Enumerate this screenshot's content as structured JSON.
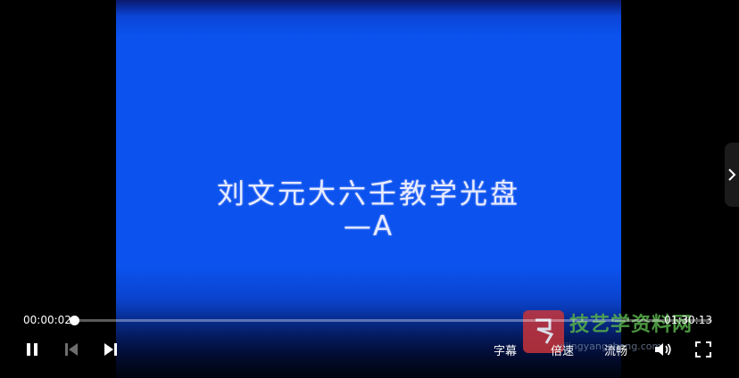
{
  "video": {
    "title_line1": "刘文元大六壬教学光盘",
    "title_line2": "—A",
    "background_color": "#0b52ee"
  },
  "player": {
    "current_time": "00:00:02",
    "total_time": "01:30:13",
    "progress_fraction": 0.001,
    "subtitle_label": "字幕",
    "speed_label": "倍速",
    "quality_label": "流畅"
  },
  "watermark": {
    "name": "技艺学资料网",
    "url": "yijingyangsheng.com",
    "brand_color": "#58b04a"
  },
  "icons": [
    "pause-icon",
    "previous-icon",
    "next-icon",
    "volume-icon",
    "fullscreen-icon",
    "chevron-right-icon"
  ]
}
